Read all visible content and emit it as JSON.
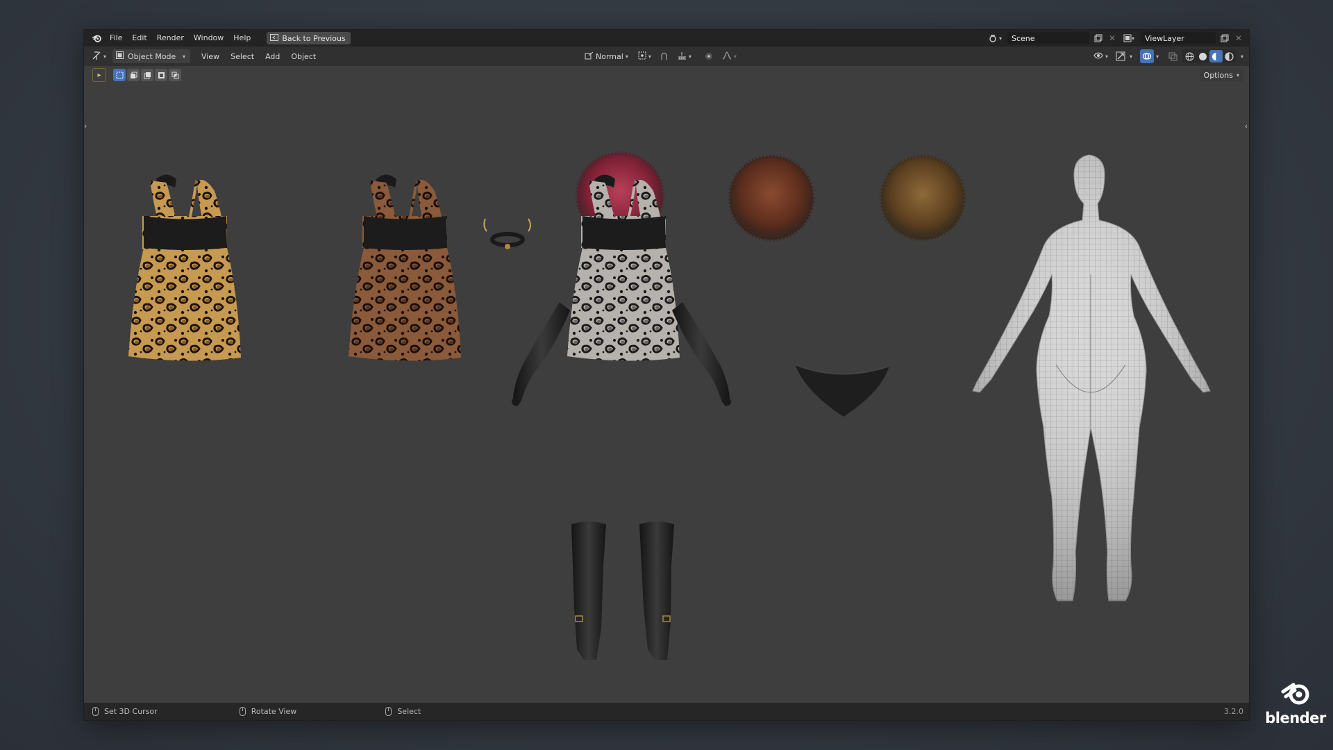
{
  "topbar": {
    "menus": [
      "File",
      "Edit",
      "Render",
      "Window",
      "Help"
    ],
    "back_button": "Back to Previous",
    "scene": "Scene",
    "view_layer": "ViewLayer"
  },
  "header": {
    "mode": "Object Mode",
    "menus": [
      "View",
      "Select",
      "Add",
      "Object"
    ],
    "transform_orientation": "Normal"
  },
  "tool_settings": {
    "options_label": "Options"
  },
  "viewport": {
    "objects": [
      "leopard-dress-1",
      "leopard-dress-2",
      "choker-necklace",
      "hair-red-afro",
      "hair-auburn-afro",
      "hair-brown-afro",
      "leopard-dress-3-grey",
      "left-long-glove",
      "right-long-glove",
      "panties",
      "base-body-mesh",
      "boots"
    ],
    "shading_mode": "material-preview"
  },
  "statusbar": {
    "items": [
      "Set 3D Cursor",
      "Rotate View",
      "Select"
    ],
    "version": "3.2.0"
  },
  "watermark": {
    "text": "blender"
  },
  "colors": {
    "accent": "#4772b3",
    "topbar_bg": "#232323",
    "header_bg": "#303030",
    "viewport_bg": "#3e3e3e",
    "statusbar_bg": "#262626"
  }
}
